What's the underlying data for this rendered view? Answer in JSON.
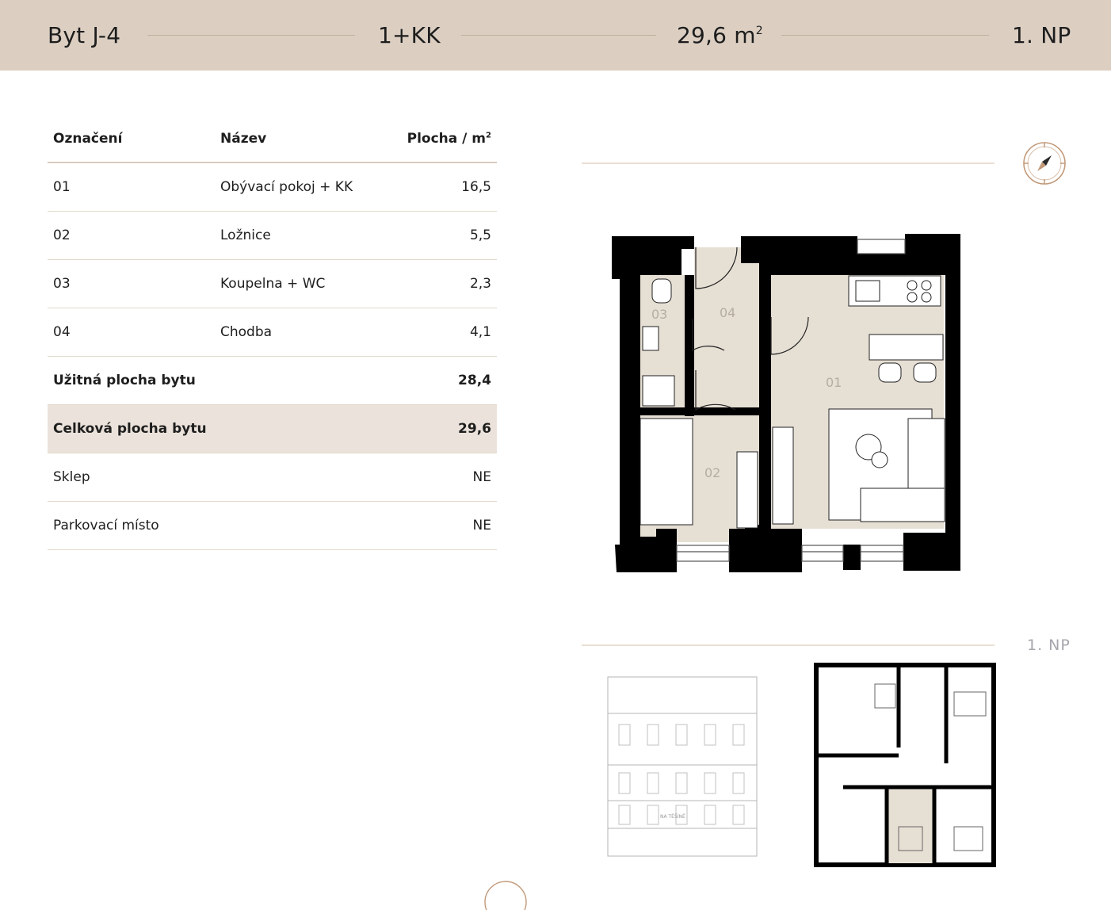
{
  "header": {
    "unit": "Byt J-4",
    "layout": "1+KK",
    "area_value": "29,6 m",
    "area_sup": "2",
    "floor": "1. NP"
  },
  "table": {
    "columns": {
      "code": "Označení",
      "name": "Název",
      "area": "Plocha / m",
      "area_sup": "2"
    },
    "rooms": [
      {
        "code": "01",
        "name": "Obývací pokoj + KK",
        "area": "16,5"
      },
      {
        "code": "02",
        "name": "Ložnice",
        "area": "5,5"
      },
      {
        "code": "03",
        "name": "Koupelna + WC",
        "area": "2,3"
      },
      {
        "code": "04",
        "name": "Chodba",
        "area": "4,1"
      }
    ],
    "usable": {
      "label": "Užitná plocha bytu",
      "value": "28,4"
    },
    "total": {
      "label": "Celková plocha bytu",
      "value": "29,6"
    },
    "cellar": {
      "label": "Sklep",
      "value": "NE"
    },
    "parking": {
      "label": "Parkovací místo",
      "value": "NE"
    }
  },
  "plan_labels": {
    "r01": "01",
    "r02": "02",
    "r03": "03",
    "r04": "04"
  },
  "floor_label": "1. NP",
  "facade_sign": "NA TĚŠÍNĚ",
  "icons": {
    "compass": "compass-icon"
  },
  "colors": {
    "header_bg": "#dccfc2",
    "shade_row": "#ebe3db",
    "floor_fill": "#e8e1d6",
    "wall": "#000000",
    "accent": "#c29a7a"
  }
}
